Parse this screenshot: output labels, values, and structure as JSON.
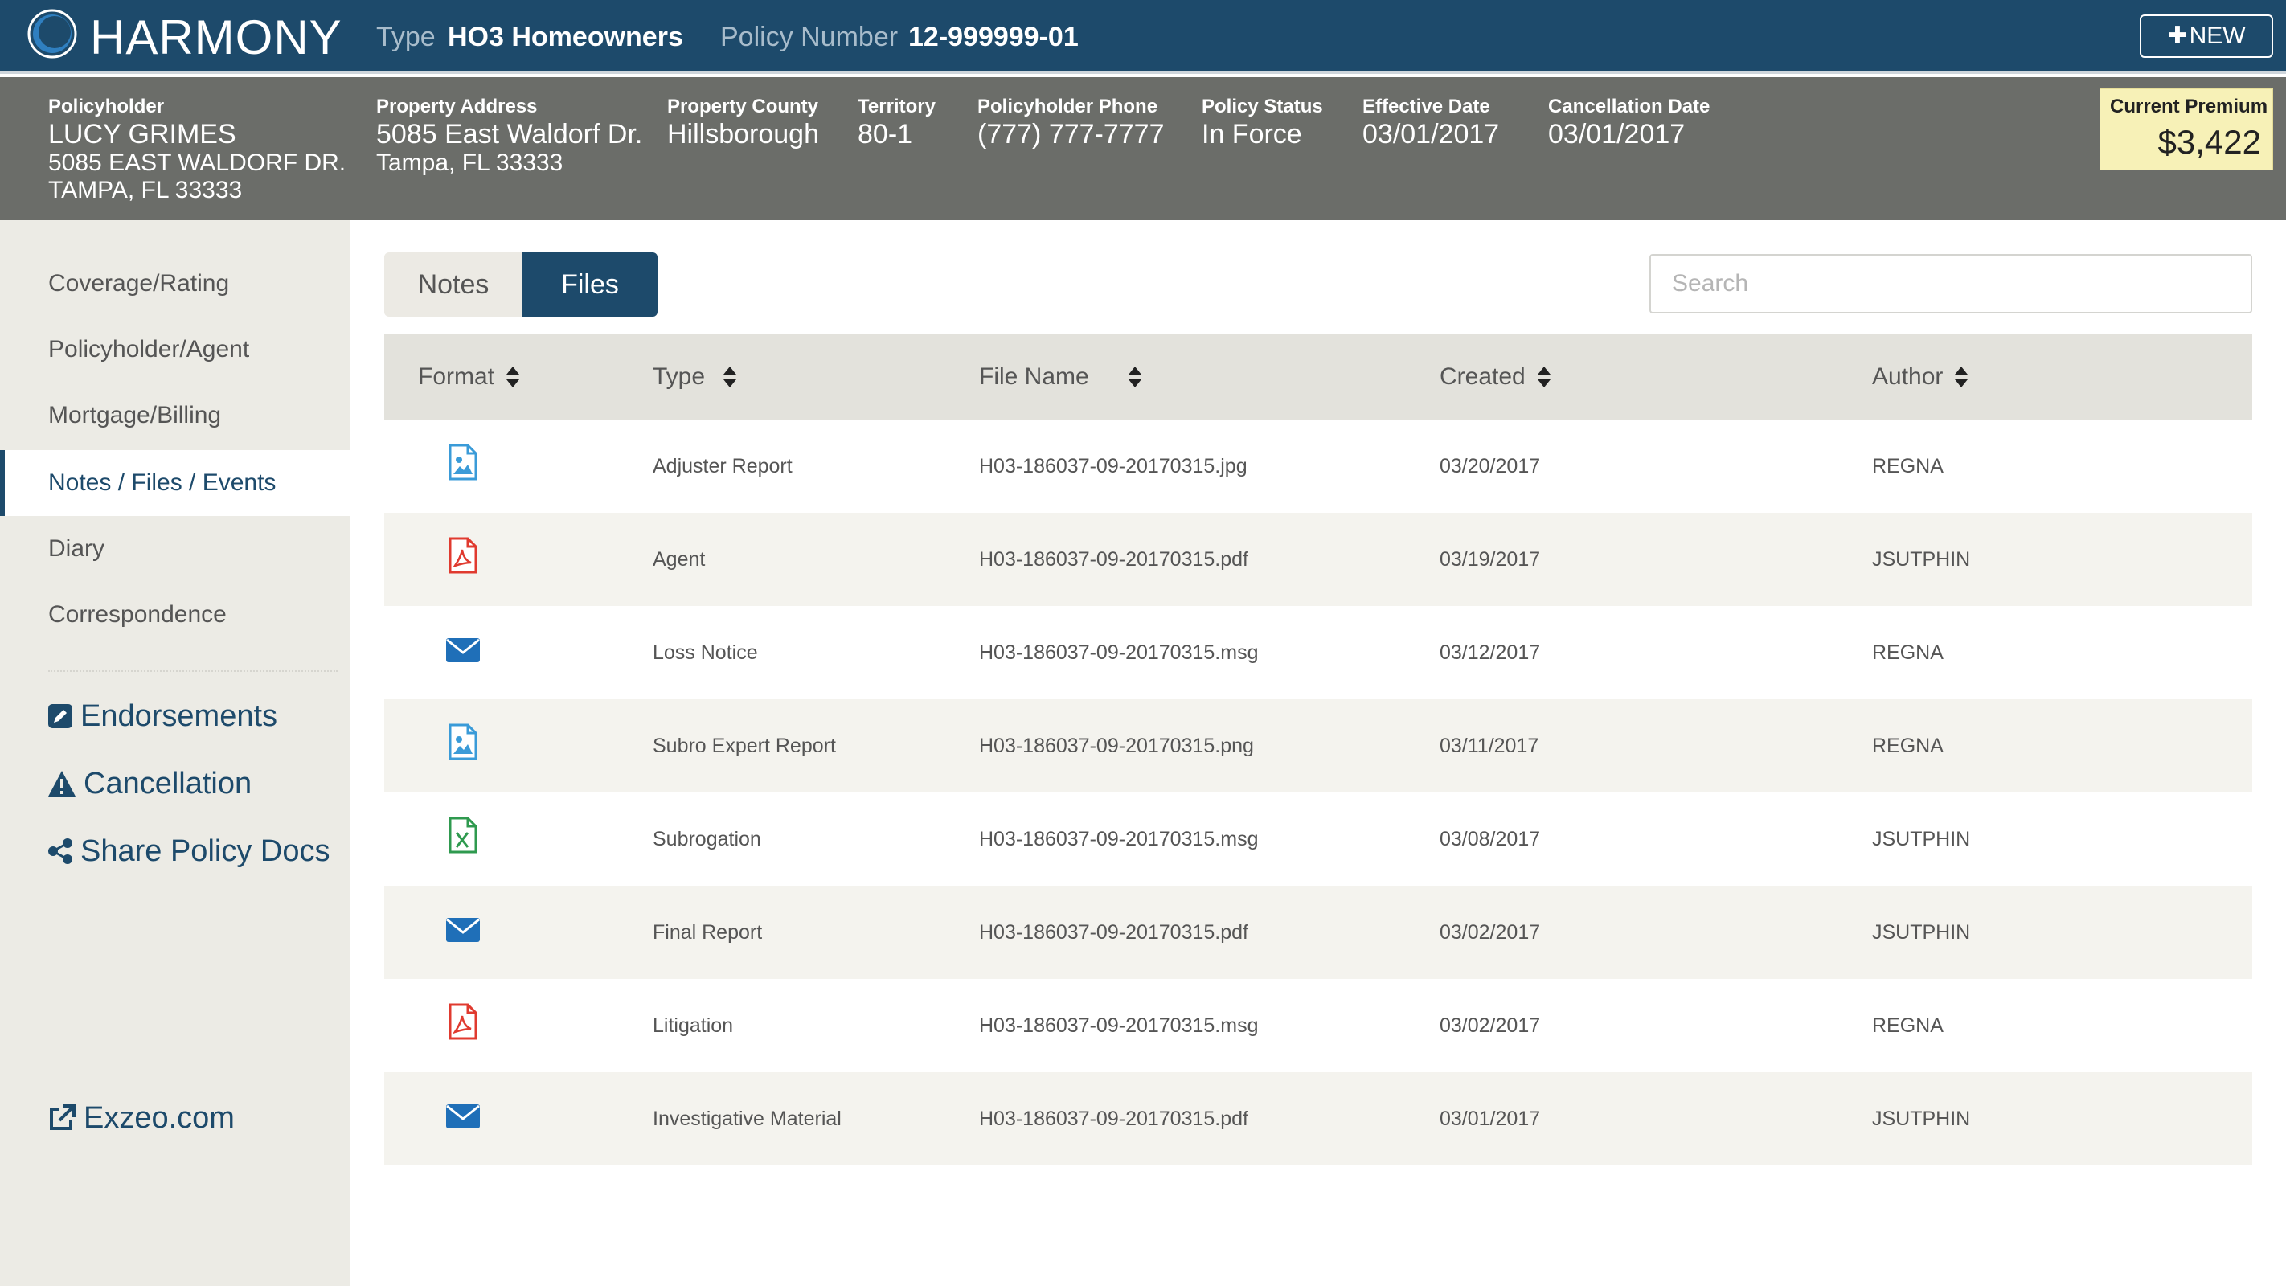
{
  "app": {
    "logo_text": "HARMONY",
    "type_label": "Type",
    "type_value": "HO3 Homeowners",
    "policy_number_label": "Policy Number",
    "policy_number_value": "12-999999-01",
    "new_button_label": "NEW"
  },
  "policy": {
    "holder_label": "Policyholder",
    "holder_name": "LUCY GRIMES",
    "holder_address_line1": "5085 EAST WALDORF DR.",
    "holder_address_line2": "TAMPA, FL 33333",
    "property_address_label": "Property Address",
    "property_address_line1": "5085 East Waldorf Dr.",
    "property_address_line2": "Tampa, FL 33333",
    "county_label": "Property County",
    "county_value": "Hillsborough",
    "territory_label": "Territory",
    "territory_value": "80-1",
    "phone_label": "Policyholder Phone",
    "phone_value": "(777) 777-7777",
    "status_label": "Policy Status",
    "status_value": "In Force",
    "effective_label": "Effective Date",
    "effective_value": "03/01/2017",
    "cancellation_label": "Cancellation Date",
    "cancellation_value": "03/01/2017",
    "premium_label": "Current Premium",
    "premium_value": "$3,422"
  },
  "sidebar": {
    "nav": [
      {
        "label": "Coverage/Rating",
        "active": false
      },
      {
        "label": "Policyholder/Agent",
        "active": false
      },
      {
        "label": "Mortgage/Billing",
        "active": false
      },
      {
        "label": "Notes / Files / Events",
        "active": true
      },
      {
        "label": "Diary",
        "active": false
      },
      {
        "label": "Correspondence",
        "active": false
      }
    ],
    "actions": [
      {
        "label": "Endorsements",
        "icon": "edit-icon"
      },
      {
        "label": "Cancellation",
        "icon": "warning-icon"
      },
      {
        "label": "Share Policy Docs",
        "icon": "share-icon"
      }
    ],
    "external_link": {
      "label": "Exzeo.com",
      "icon": "external-link-icon"
    }
  },
  "tabs": [
    {
      "label": "Notes",
      "active": false
    },
    {
      "label": "Files",
      "active": true
    }
  ],
  "search": {
    "placeholder": "Search",
    "value": ""
  },
  "table": {
    "columns": [
      "Format",
      "Type",
      "File Name",
      "Created",
      "Author"
    ],
    "rows": [
      {
        "format": "image",
        "type": "Adjuster Report",
        "file_name": "H03-186037-09-20170315.jpg",
        "created": "03/20/2017",
        "author": "REGNA"
      },
      {
        "format": "pdf",
        "type": "Agent",
        "file_name": "H03-186037-09-20170315.pdf",
        "created": "03/19/2017",
        "author": "JSUTPHIN"
      },
      {
        "format": "email",
        "type": "Loss Notice",
        "file_name": "H03-186037-09-20170315.msg",
        "created": "03/12/2017",
        "author": "REGNA"
      },
      {
        "format": "image",
        "type": "Subro Expert Report",
        "file_name": "H03-186037-09-20170315.png",
        "created": "03/11/2017",
        "author": "REGNA"
      },
      {
        "format": "excel",
        "type": "Subrogation",
        "file_name": "H03-186037-09-20170315.msg",
        "created": "03/08/2017",
        "author": "JSUTPHIN"
      },
      {
        "format": "email",
        "type": "Final Report",
        "file_name": "H03-186037-09-20170315.pdf",
        "created": "03/02/2017",
        "author": "JSUTPHIN"
      },
      {
        "format": "pdf",
        "type": "Litigation",
        "file_name": "H03-186037-09-20170315.msg",
        "created": "03/02/2017",
        "author": "REGNA"
      },
      {
        "format": "email",
        "type": "Investigative Material",
        "file_name": "H03-186037-09-20170315.pdf",
        "created": "03/01/2017",
        "author": "JSUTPHIN"
      }
    ]
  },
  "colors": {
    "brand": "#1d4a6b",
    "header_gray": "#6b6d69",
    "premium_bg": "#f7f1b7",
    "image_icon": "#3a9bd8",
    "pdf_icon": "#e03a2f",
    "email_icon": "#1f6fb8",
    "excel_icon": "#2f9a4f"
  }
}
